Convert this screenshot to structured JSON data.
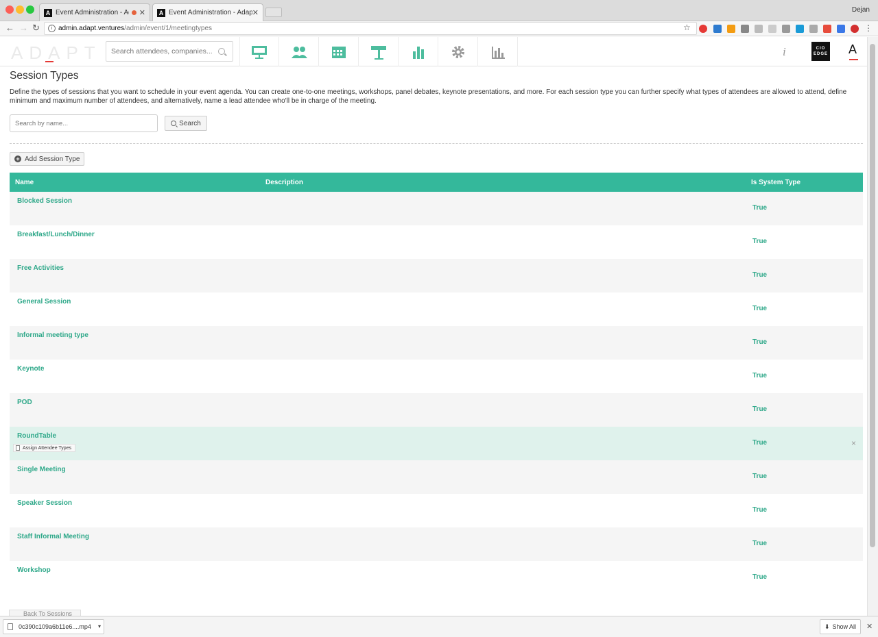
{
  "browser": {
    "tabs": [
      {
        "title": "Event Administration - Adap"
      },
      {
        "title": "Event Administration - Adapt"
      }
    ],
    "profile_name": "Dejan",
    "url_host": "admin.adapt.ventures",
    "url_path": "/admin/event/1/meetingtypes"
  },
  "app": {
    "logo_text": "ADAPT",
    "search_placeholder": "Search attendees, companies...",
    "nav_icons": [
      "presentation-icon",
      "people-icon",
      "calendar-icon",
      "signpost-icon",
      "bar-chart-icon",
      "gear-icon",
      "analytics-icon"
    ],
    "info_label": "i",
    "cio_badge": "CIO EDGE",
    "account_letter": "A",
    "accent_color": "#34b89b"
  },
  "page": {
    "title": "Session Types",
    "description": "Define the types of sessions that you want to schedule in your event agenda. You can create one-to-one meetings, workshops, panel debates, keynote presentations, and more. For each session type you can further specify what types of attendees are allowed to attend, define minimum and maximum number of attendees, and alternatively, name a lead attendee who'll be in charge of the meeting.",
    "filter_placeholder": "Search by name...",
    "search_button": "Search",
    "add_button": "Add Session Type",
    "back_button": "Back To Sessions"
  },
  "table": {
    "columns": {
      "name": "Name",
      "description": "Description",
      "system": "Is System Type"
    },
    "rows": [
      {
        "name": "Blocked Session",
        "description": "",
        "system": "True"
      },
      {
        "name": "Breakfast/Lunch/Dinner",
        "description": "",
        "system": "True"
      },
      {
        "name": "Free Activities",
        "description": "",
        "system": "True"
      },
      {
        "name": "General Session",
        "description": "",
        "system": "True"
      },
      {
        "name": "Informal meeting type",
        "description": "",
        "system": "True"
      },
      {
        "name": "Keynote",
        "description": "",
        "system": "True"
      },
      {
        "name": "POD",
        "description": "",
        "system": "True"
      },
      {
        "name": "RoundTable",
        "description": "",
        "system": "True"
      },
      {
        "name": "Single Meeting",
        "description": "",
        "system": "True"
      },
      {
        "name": "Speaker Session",
        "description": "",
        "system": "True"
      },
      {
        "name": "Staff Informal Meeting",
        "description": "",
        "system": "True"
      },
      {
        "name": "Workshop",
        "description": "",
        "system": "True"
      }
    ],
    "hover_action": "Assign Attendee Types",
    "hover_remove": "×"
  },
  "downloads": {
    "file_name": "0c390c109a6b11e6....mp4",
    "show_all": "Show All"
  }
}
